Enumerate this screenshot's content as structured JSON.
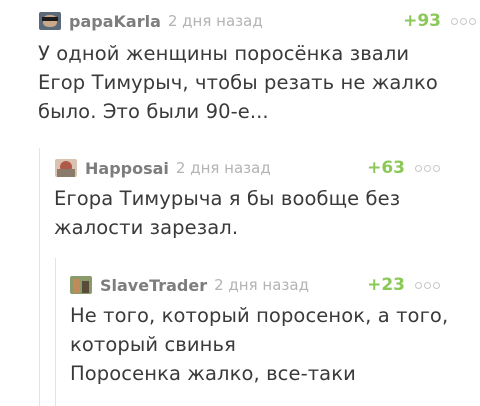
{
  "comments": [
    {
      "username": "papaKarla",
      "time": "2 дня назад",
      "rating": "+93",
      "lines": [
        "У одной женщины поросёнка звали",
        "Егор Тимурыч, чтобы резать не жалко",
        "было. Это были 90-е..."
      ]
    },
    {
      "username": "Happosai",
      "time": "2 дня назад",
      "rating": "+63",
      "lines": [
        "Егора Тимурыча я бы вообще без",
        "жалости зарезал."
      ]
    },
    {
      "username": "SlaveTrader",
      "time": "2 дня назад",
      "rating": "+23",
      "lines": [
        "Не того, который поросенок, а того,",
        "который свинья",
        "Поросенка жалко, все-таки"
      ]
    }
  ],
  "colors": {
    "rating": "#8ac858",
    "username": "#7d7d7d",
    "time": "#b3b3b3",
    "thread_line": "#e4e4e4"
  }
}
